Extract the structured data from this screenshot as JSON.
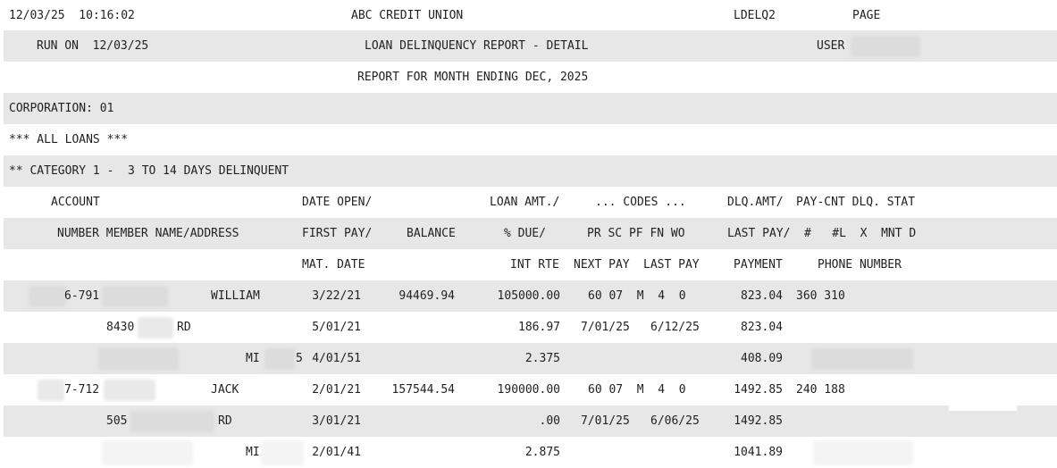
{
  "header": {
    "datetime": "12/03/25  10:16:02",
    "org": "ABC CREDIT UNION",
    "program": "LDELQ2",
    "page_label": "PAGE",
    "run_on": "RUN ON  12/03/25",
    "title": "LOAN DELINQUENCY REPORT - DETAIL",
    "user_label": "USER",
    "subtitle": "REPORT FOR MONTH ENDING DEC, 2025",
    "corporation": "CORPORATION: 01",
    "all_loans": "*** ALL LOANS ***",
    "category": "** CATEGORY 1 -  3 TO 14 DAYS DELINQUENT"
  },
  "columns": {
    "r1": {
      "account": "ACCOUNT",
      "date": "DATE OPEN/",
      "loan": "LOAN AMT./",
      "codes": "... CODES ...",
      "dlq": "DLQ.AMT/",
      "paycnt": "PAY-CNT DLQ. STAT"
    },
    "r2": {
      "number": "NUMBER MEMBER NAME/ADDRESS",
      "date": "FIRST PAY/",
      "balance": "BALANCE",
      "due": "% DUE/",
      "codes": "PR SC PF FN WO",
      "dlq": "LAST PAY/",
      "paycnt": "#   #L  X  MNT D"
    },
    "r3": {
      "date": "MAT. DATE",
      "int": "INT RTE",
      "next": "NEXT PAY",
      "last": "LAST PAY",
      "payment": "PAYMENT",
      "phone": "PHONE NUMBER"
    }
  },
  "records": [
    {
      "account": "6-791",
      "name": "WILLIAM",
      "address": "8430",
      "street_suffix": "RD",
      "state": "MI",
      "zip_tail": "5",
      "date_open": "3/22/21",
      "first_pay": "5/01/21",
      "mat_date": "4/01/51",
      "balance": "94469.94",
      "loan_amt": "105000.00",
      "pct_due": "186.97",
      "int_rte": "2.375",
      "codes": "60 07  M  4  0",
      "next_pay": "7/01/25",
      "last_pay": "6/12/25",
      "dlq_amt": "823.04",
      "last_pay_amt": "823.04",
      "payment": "408.09",
      "phone": "360 310"
    },
    {
      "account": "7-712",
      "name": "JACK",
      "address": "505",
      "street_suffix": "RD",
      "state": "MI",
      "zip_tail": "",
      "date_open": "2/01/21",
      "first_pay": "3/01/21",
      "mat_date": "2/01/41",
      "balance": "157544.54",
      "loan_amt": "190000.00",
      "pct_due": ".00",
      "int_rte": "2.875",
      "codes": "60 07  M  4  0",
      "next_pay": "7/01/25",
      "last_pay": "6/06/25",
      "dlq_amt": "1492.85",
      "last_pay_amt": "1492.85",
      "payment": "1041.89",
      "phone": "240 188"
    }
  ]
}
